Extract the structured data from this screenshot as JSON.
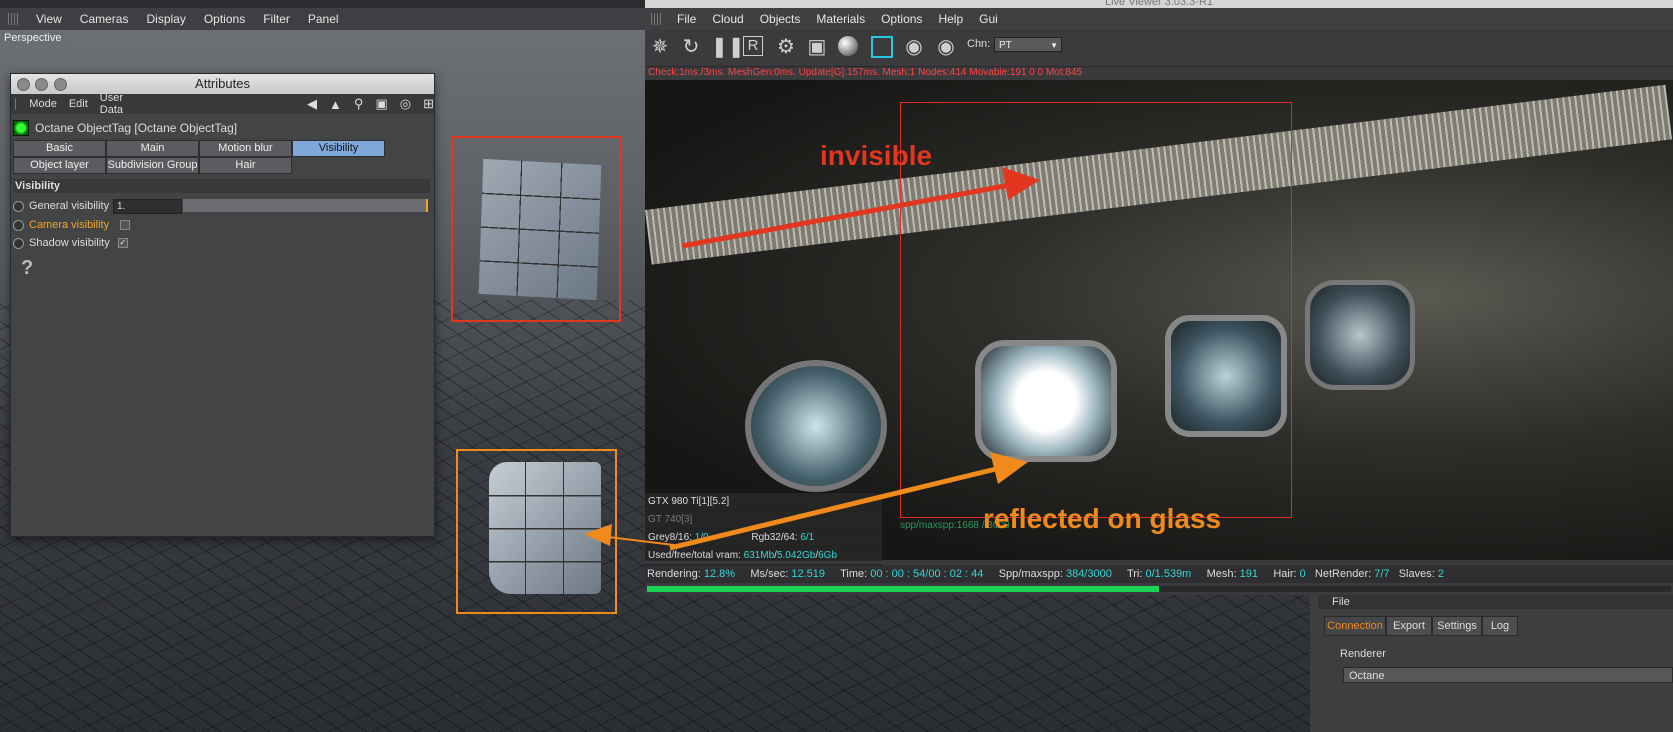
{
  "viewport": {
    "menu": [
      "View",
      "Cameras",
      "Display",
      "Options",
      "Filter",
      "Panel"
    ],
    "view_label": "Perspective"
  },
  "attributes": {
    "title": "Attributes",
    "toolbar": [
      "Mode",
      "Edit",
      "User Data"
    ],
    "tag_name": "Octane ObjectTag [Octane ObjectTag]",
    "tabs_row1": [
      "Basic",
      "Main",
      "Motion blur",
      "Visibility"
    ],
    "tabs_row2": [
      "Object layer",
      "Subdivision Group",
      "Hair"
    ],
    "active_tab": "Visibility",
    "section": "Visibility",
    "general_visibility": {
      "label": "General visibility",
      "value": "1."
    },
    "camera_visibility": {
      "label": "Camera visibility",
      "checked": false
    },
    "shadow_visibility": {
      "label": "Shadow visibility",
      "checked": true
    },
    "help": "?"
  },
  "live_viewer": {
    "title": "Live Viewer 3.03.3-R1",
    "menu": [
      "File",
      "Cloud",
      "Objects",
      "Materials",
      "Options",
      "Help",
      "Gui"
    ],
    "channel_label": "Chn:",
    "channel_value": "PT",
    "stats_line": "Check:1ms./3ms. MeshGen:0ms. Update[G]:157ms. Mesh:1 Nodes:414 Movable:191  0 0 Mot:845",
    "gpu": {
      "gpu1": "GTX 980 Ti[1][5.2]",
      "gpu2": "GT 740[3]",
      "grey_label": "Grey8/16:",
      "grey_value": "1/0",
      "rgb_label": "Rgb32/64:",
      "rgb_value": "6/1",
      "vram_label": "Used/free/total vram:",
      "vram_used": "631Mb",
      "vram_free": "5.042Gb",
      "vram_total": "6Gb"
    },
    "spp_overlay": "spp/maxspp:1668 / 3000",
    "status": {
      "rendering_label": "Rendering:",
      "rendering": "12.8%",
      "mssec_label": "Ms/sec:",
      "mssec": "12.519",
      "time_label": "Time:",
      "time": "00 : 00 : 54/00 : 02 : 44",
      "spp_label": "Spp/maxspp:",
      "spp": "384/3000",
      "tri_label": "Tri:",
      "tri": "0/1.539m",
      "mesh_label": "Mesh:",
      "mesh": "191",
      "hair_label": "Hair:",
      "hair": "0",
      "netrender_label": "NetRender:",
      "netrender": "7/7",
      "slaves_label": "Slaves:",
      "slaves": "2"
    },
    "progress": 0.5
  },
  "annotations": {
    "invisible": "invisible",
    "reflected": "reflected on glass",
    "colors": {
      "red": "#e3361e",
      "orange": "#f08a1c"
    }
  },
  "settings_panel": {
    "file_label": "File",
    "tabs": [
      "Connection",
      "Export",
      "Settings",
      "Log"
    ],
    "active_tab": "Connection",
    "renderer_label": "Renderer",
    "renderer_value": "Octane"
  }
}
